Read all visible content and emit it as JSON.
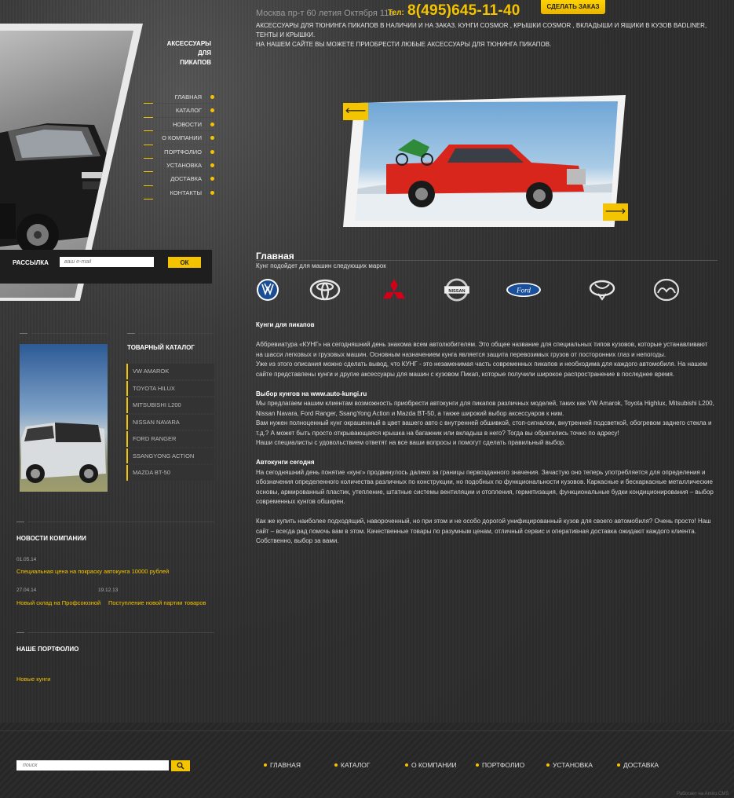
{
  "header": {
    "address": "Москва пр-т 60 летия Октября 11а",
    "tel_label": "Тел:",
    "phone": "8(495)645-11-40",
    "order_button": "СДЕЛАТЬ ЗАКАЗ",
    "tagline_1": "АКСЕССУАРЫ ДЛЯ ТЮНИНГА ПИКАПОВ В НАЛИЧИИ И НА ЗАКАЗ. КУНГИ COSMOR , КРЫШКИ COSMOR , ВКЛАДЫШИ И ЯЩИКИ В КУЗОВ BADLINER, ТЕНТЫ И КРЫШКИ.",
    "tagline_2": "НА НАШЕМ САЙТЕ ВЫ МОЖЕТЕ ПРИОБРЕСТИ ЛЮБЫЕ АКСЕССУАРЫ ДЛЯ ТЮНИНГА ПИКАПОВ."
  },
  "brand": {
    "line1": "АКСЕССУАРЫ",
    "line2": "ДЛЯ ПИКАПОВ"
  },
  "nav": [
    {
      "label": "ГЛАВНАЯ"
    },
    {
      "label": "КАТАЛОГ"
    },
    {
      "label": "НОВОСТИ"
    },
    {
      "label": "О КОМПАНИИ"
    },
    {
      "label": "ПОРТФОЛИО"
    },
    {
      "label": "УСТАНОВКА"
    },
    {
      "label": "ДОСТАВКА"
    },
    {
      "label": "КОНТАКТЫ"
    }
  ],
  "subscribe": {
    "label": "РАССЫЛКА",
    "placeholder": "ваш e-mail",
    "button": "ОК"
  },
  "slider": {
    "prev_icon": "arrow-left-icon",
    "next_icon": "arrow-right-icon",
    "prev_glyph": "🡐",
    "next_glyph": "🡒"
  },
  "main": {
    "title": "Главная",
    "subtitle": "Кунг подойдет для машин следующих марок",
    "brands": [
      "volkswagen-logo-icon",
      "toyota-logo-icon",
      "mitsubishi-logo-icon",
      "nissan-logo-icon",
      "ford-logo-icon",
      "ssangyong-logo-icon",
      "mazda-logo-icon"
    ],
    "nissan_text": "NISSAN",
    "ford_text": "Ford"
  },
  "article": {
    "h1": "Кунги для пикапов",
    "p1": "Аббревиатура «КУНГ» на сегодняшний день знакома всем автолюбителям. Это общее название для специальных типов кузовов, которые устанавливают на шасси легковых и грузовых машин. Основным назначением кунга является защита перевозимых грузов от посторонних глаз и непогоды.",
    "p2": "Уже из этого описания можно сделать вывод, что КУНГ - это незаменимая часть современных пикапов и необходима для каждого автомобиля. На нашем сайте представлены кунги и другие аксессуары для машин с кузовом Пикап, которые получили широкое распространение в последнее время.",
    "h2": "Выбор кунгов на www.auto-kungi.ru",
    "p3": "Мы предлагаем нашим клиентам возможность приобрести автокунги для пикапов различных моделей, таких как VW Amarok, Toyota Highlux, Mitsubishi L200, Nissan Navara, Ford Ranger, SsangYong Action и Mazda BT-50, а также широкий выбор аксессуаров к ним.",
    "p4": "Вам нужен полноценный кунг окрашенный в цвет вашего авто с внутренней обшивкой, стоп-сигналом, внутренней подсветкой, обогревом заднего стекла и т.д.? А может быть просто открывающаяся крышка на багажник или вкладыш в него? Тогда вы обратились точно по адресу!",
    "p5": "Наши специалисты с удовольствием ответят на все ваши вопросы и помогут сделать правильный выбор.",
    "h3": "Автокунги сегодня",
    "p6": "На сегодняшний день понятие «кунг» продвинулось далеко за границы первозданного значения. Зачастую оно теперь употребляется для определения и обозначения определенного количества различных по конструкции, но подобных по функциональности кузовов. Каркасные и бескаркасные металлические основы, армированный пластик, утепление, штатные системы вентиляции и отопления, герметизация, функциональные будки кондиционирования – выбор современных кунгов обширен.",
    "p7": "Как же купить наиболее подходящий, навороченный, но при этом и не особо дорогой унифицированный кузов для своего автомобиля? Очень просто! Наш сайт – всегда рад помочь вам в этом. Качественные товары по разумным ценам, отличный сервис и оперативная доставка ожидают каждого клиента. Собственно, выбор за вами."
  },
  "catalog": {
    "title": "ТОВАРНЫЙ КАТАЛОГ",
    "items": [
      "VW AMAROK",
      "TOYOTA HILUX",
      "MITSUBISHI L200",
      "NISSAN NAVARA",
      "FORD RANGER",
      "SSANGYONG ACTION",
      "MAZDA BT-50"
    ]
  },
  "news": {
    "title": "НОВОСТИ КОМПАНИИ",
    "items": [
      {
        "date": "01.05.14",
        "text": "Специальная цена на покраску автокунга 10000 рублей"
      },
      {
        "date": "27.04.14",
        "text": "Новый склад на Профсоюзной"
      },
      {
        "date": "19.12.13",
        "text": "Поступление новой партии товаров"
      }
    ]
  },
  "portfolio": {
    "title": "НАШЕ ПОРТФОЛИО",
    "link": "Новые кунги"
  },
  "footer": {
    "search_placeholder": "поиск",
    "nav": [
      "ГЛАВНАЯ",
      "КАТАЛОГ",
      "О КОМПАНИИ",
      "ПОРТФОЛИО",
      "УСТАНОВКА",
      "ДОСТАВКА"
    ],
    "powered": "Работает на Amiro.CMS"
  },
  "colors": {
    "accent": "#f5c400",
    "background": "#2b2b2b"
  }
}
